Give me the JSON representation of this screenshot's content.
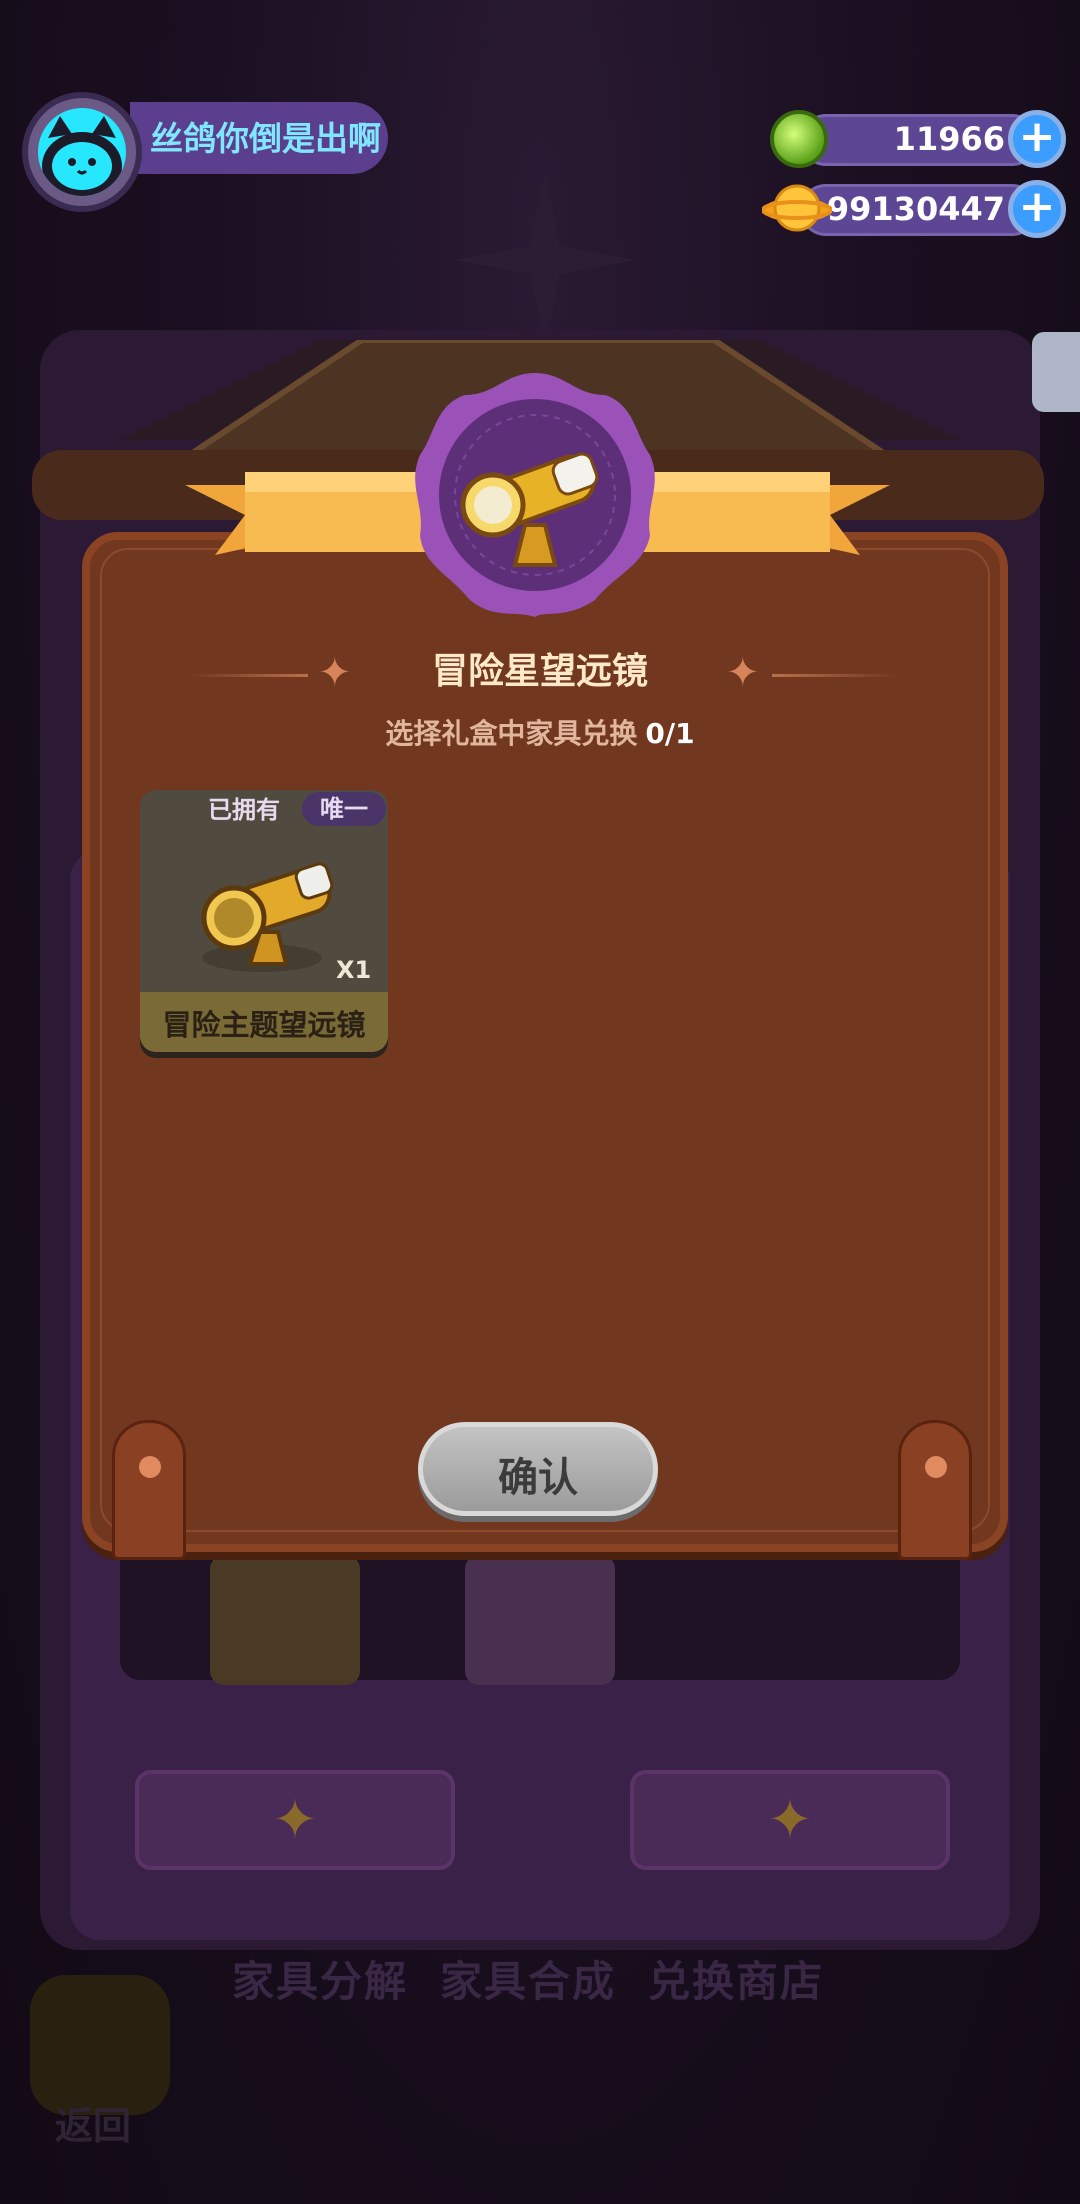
{
  "player": {
    "name": "丝鸽你倒是出啊"
  },
  "currencies": [
    {
      "name": "gem",
      "amount": "11966"
    },
    {
      "name": "coin",
      "amount": "99130447"
    }
  ],
  "modal": {
    "title": "冒险星望远镜",
    "subtitle": "选择礼盒中家具兑换",
    "progress": "0/1",
    "items": [
      {
        "name": "冒险主题望远镜",
        "owned_badge": "已拥有",
        "unique_badge": "唯一",
        "quantity": "X1"
      }
    ],
    "confirm_label": "确认"
  },
  "background": {
    "tabs": [
      "家具分解",
      "家具合成",
      "兑换商店"
    ],
    "back_label": "返回"
  },
  "colors": {
    "panel": "#72371f",
    "ribbon": "#f4b34c",
    "emblem": "#7a3f96",
    "name_text": "#7fe7ff",
    "confirm": "#b0b0b0"
  },
  "icons": [
    "telescope-icon",
    "gem-icon",
    "coin-icon",
    "plus-icon",
    "cat-avatar-icon",
    "star-icon"
  ]
}
